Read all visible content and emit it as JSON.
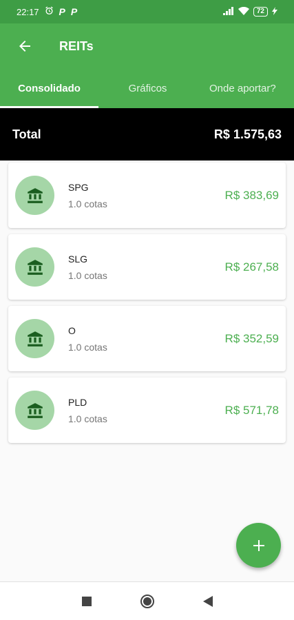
{
  "status_bar": {
    "time": "22:17",
    "notif1": "P",
    "notif2": "P",
    "battery": "72"
  },
  "app_bar": {
    "title": "REITs"
  },
  "tabs": [
    {
      "label": "Consolidado",
      "active": true
    },
    {
      "label": "Gráficos",
      "active": false
    },
    {
      "label": "Onde aportar?",
      "active": false
    }
  ],
  "total": {
    "label": "Total",
    "value": "R$ 1.575,63"
  },
  "assets": [
    {
      "ticker": "SPG",
      "quantity": "1.0 cotas",
      "value": "R$ 383,69",
      "icon": "bank-icon"
    },
    {
      "ticker": "SLG",
      "quantity": "1.0 cotas",
      "value": "R$ 267,58",
      "icon": "bank-icon"
    },
    {
      "ticker": "O",
      "quantity": "1.0 cotas",
      "value": "R$ 352,59",
      "icon": "bank-icon"
    },
    {
      "ticker": "PLD",
      "quantity": "1.0 cotas",
      "value": "R$ 571,78",
      "icon": "bank-icon"
    }
  ],
  "fab": {
    "label": "+"
  },
  "colors": {
    "primary": "#4caf50",
    "primary_dark": "#3e9d45",
    "avatar_bg": "#a5d6a7",
    "value_text": "#4caf50"
  }
}
